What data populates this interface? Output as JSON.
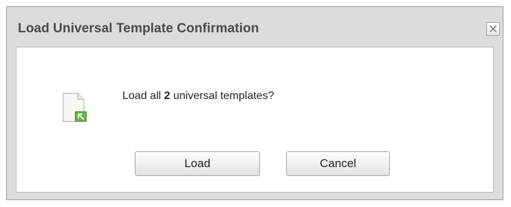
{
  "dialog": {
    "title": "Load Universal Template Confirmation",
    "close_icon": "close-icon",
    "message_prefix": "Load all ",
    "message_count": "2",
    "message_suffix": " universal templates?",
    "document_icon": "template-load-icon",
    "load_label": "Load",
    "cancel_label": "Cancel"
  },
  "colors": {
    "title_text": "#4a4a4a",
    "frame_background": "#dcdcdc",
    "icon_accent": "#6ab04c"
  }
}
